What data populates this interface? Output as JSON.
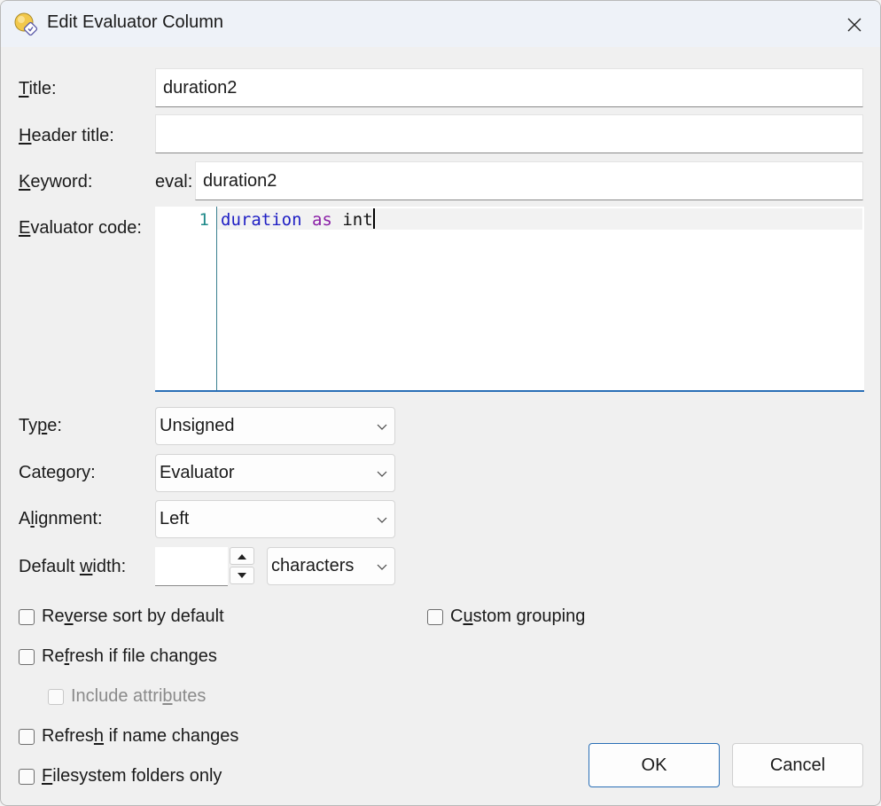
{
  "window": {
    "title": "Edit Evaluator Column"
  },
  "icons": {
    "app": "evaluator-app-icon",
    "close": "close-icon",
    "chevron": "chevron-down-icon",
    "up": "spin-up-icon",
    "down": "spin-down-icon"
  },
  "form": {
    "title": {
      "label_u": "T",
      "label_rest": "itle:",
      "value": "duration2"
    },
    "header_title": {
      "label_u": "H",
      "label_rest": "eader title:",
      "value": ""
    },
    "keyword": {
      "label_u": "K",
      "label_rest": "eyword:",
      "prefix": "eval:",
      "value": "duration2"
    },
    "evaluator_code": {
      "label_u": "E",
      "label_rest": "valuator code:",
      "line_number": "1",
      "tokens": {
        "t1": "duration",
        "sp1": " ",
        "t2": "as",
        "sp2": " ",
        "t3": "int"
      }
    },
    "type": {
      "label_pre": "Ty",
      "label_u": "p",
      "label_post": "e:",
      "value": "Unsigned"
    },
    "category": {
      "label_pre": "Cate",
      "label_u": "g",
      "label_post": "ory:",
      "value": "Evaluator"
    },
    "alignment": {
      "label_pre": "A",
      "label_u": "l",
      "label_post": "ignment:",
      "value": "Left"
    },
    "default_width": {
      "label_pre": "Default ",
      "label_u": "w",
      "label_post": "idth:",
      "value": "",
      "unit": "characters"
    }
  },
  "checkboxes": {
    "reverse_sort": {
      "pre": "Re",
      "u": "v",
      "post": "erse sort by default",
      "checked": false
    },
    "custom_grouping": {
      "pre": "C",
      "u": "u",
      "post": "stom grouping",
      "checked": false
    },
    "refresh_file": {
      "pre": "Re",
      "u": "f",
      "post": "resh if file changes",
      "checked": false
    },
    "include_attributes": {
      "pre": "Include attri",
      "u": "b",
      "post": "utes",
      "checked": false,
      "enabled": false
    },
    "refresh_name": {
      "pre": "Refres",
      "u": "h",
      "post": " if name changes",
      "checked": false
    },
    "filesystem_only": {
      "pre": "",
      "u": "F",
      "post": "ilesystem folders only",
      "checked": false
    }
  },
  "buttons": {
    "ok": "OK",
    "cancel": "Cancel"
  },
  "colors": {
    "accent": "#2a6fb6",
    "keyword_blue": "#1f1fc4",
    "keyword_purple": "#8a1fa6",
    "line_number": "#1f8a8a"
  }
}
